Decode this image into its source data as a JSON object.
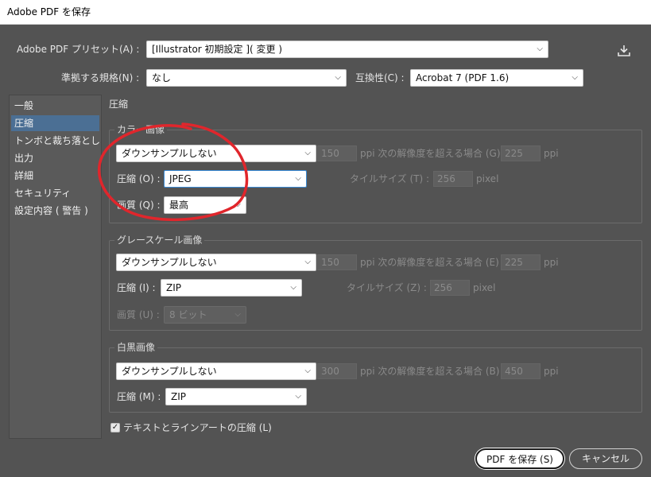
{
  "window": {
    "title": "Adobe PDF を保存"
  },
  "top": {
    "preset_label": "Adobe PDF プリセット(A) :",
    "preset_value": "[Illustrator 初期設定 ]( 変更 )",
    "standard_label": "準拠する規格(N) :",
    "standard_value": "なし",
    "compat_label": "互換性(C) :",
    "compat_value": "Acrobat 7 (PDF 1.6)"
  },
  "sidebar": {
    "items": [
      {
        "label": "一般"
      },
      {
        "label": "圧縮"
      },
      {
        "label": "トンボと裁ち落とし"
      },
      {
        "label": "出力"
      },
      {
        "label": "詳細"
      },
      {
        "label": "セキュリティ"
      },
      {
        "label": "設定内容 ( 警告 )"
      }
    ]
  },
  "main": {
    "section_title": "圧縮",
    "color": {
      "title": "カラー画像",
      "downsample": "ダウンサンプルしない",
      "ppi_value": "150",
      "ppi_text": "ppi 次の解像度を超える場合 (G)",
      "above_value": "225",
      "above_unit": "ppi",
      "compression_label": "圧縮 (O) :",
      "compression_value": "JPEG",
      "tile_label": "タイルサイズ (T) :",
      "tile_value": "256",
      "tile_unit": "pixel",
      "quality_label": "画質 (Q) :",
      "quality_value": "最高"
    },
    "gray": {
      "title": "グレースケール画像",
      "downsample": "ダウンサンプルしない",
      "ppi_value": "150",
      "ppi_text": "ppi 次の解像度を超える場合 (E)",
      "above_value": "225",
      "above_unit": "ppi",
      "compression_label": "圧縮 (I) :",
      "compression_value": "ZIP",
      "tile_label": "タイルサイズ (Z) :",
      "tile_value": "256",
      "tile_unit": "pixel",
      "quality_label": "画質 (U) :",
      "quality_value": "8 ビット"
    },
    "mono": {
      "title": "白黒画像",
      "downsample": "ダウンサンプルしない",
      "ppi_value": "300",
      "ppi_text": "ppi 次の解像度を超える場合 (B)",
      "above_value": "450",
      "above_unit": "ppi",
      "compression_label": "圧縮 (M) :",
      "compression_value": "ZIP"
    },
    "text_art_label": "テキストとラインアートの圧縮 (L)"
  },
  "buttons": {
    "save": "PDF を保存 (S)",
    "cancel": "キャンセル"
  },
  "colors": {
    "annotation_circle": "#e0262c",
    "selection": "#4b6f94",
    "panel": "#535353"
  }
}
